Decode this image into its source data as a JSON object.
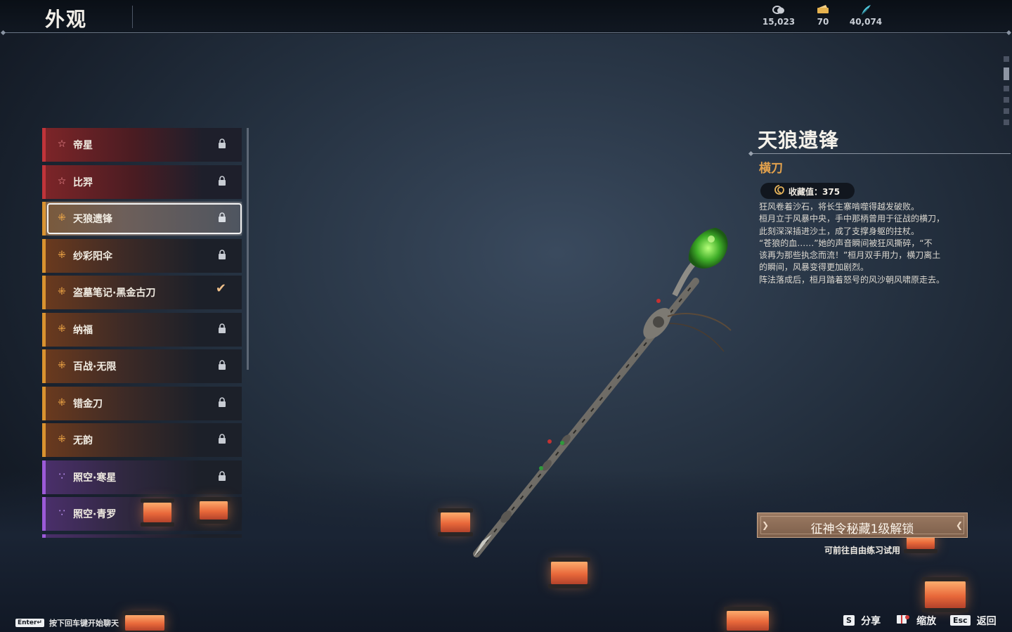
{
  "header": {
    "title": "外观",
    "currencies": [
      {
        "icon": "coin-stack-icon",
        "value": "15,023"
      },
      {
        "icon": "ticket-icon",
        "value": "70"
      },
      {
        "icon": "feather-icon",
        "value": "40,074"
      }
    ]
  },
  "list": {
    "items": [
      {
        "label": "帝星",
        "rarity": "red",
        "rarity_icon": "star-icon",
        "state": "locked"
      },
      {
        "label": "比羿",
        "rarity": "red",
        "rarity_icon": "star-icon",
        "state": "locked"
      },
      {
        "label": "天狼遗锋",
        "rarity": "gold",
        "rarity_icon": "quad-dot-icon",
        "state": "locked",
        "selected": true
      },
      {
        "label": "纱彩阳伞",
        "rarity": "gold",
        "rarity_icon": "quad-dot-icon",
        "state": "locked"
      },
      {
        "label": "盗墓笔记·黑金古刀",
        "rarity": "gold",
        "rarity_icon": "quad-dot-icon",
        "state": "owned"
      },
      {
        "label": "纳福",
        "rarity": "gold",
        "rarity_icon": "quad-dot-icon",
        "state": "locked"
      },
      {
        "label": "百战·无限",
        "rarity": "gold",
        "rarity_icon": "quad-dot-icon",
        "state": "locked"
      },
      {
        "label": "错金刀",
        "rarity": "gold",
        "rarity_icon": "quad-dot-icon",
        "state": "locked"
      },
      {
        "label": "无韵",
        "rarity": "gold",
        "rarity_icon": "quad-dot-icon",
        "state": "locked"
      },
      {
        "label": "照空·寒星",
        "rarity": "purple",
        "rarity_icon": "tri-dot-icon",
        "state": "locked"
      },
      {
        "label": "照空·青罗",
        "rarity": "purple",
        "rarity_icon": "tri-dot-icon",
        "state": "none"
      }
    ]
  },
  "detail": {
    "name": "天狼遗锋",
    "type": "横刀",
    "collection_label": "收藏值：375",
    "description": [
      "狂风卷着沙石，将长生寨啃噬得越发破败。",
      "桓月立于风暴中央，手中那柄曾用于征战的横刀，",
      "此刻深深插进沙土，成了支撑身躯的拄杖。",
      "“苍狼的血……”她的声音瞬间被狂风撕碎，“不",
      "该再为那些执念而流！”桓月双手用力，横刀离土",
      "的瞬间，风暴变得更加剧烈。",
      "阵法落成后，桓月踏着怒号的风沙朝风啸原走去。"
    ],
    "unlock_button": "征神令秘藏1级解锁",
    "unlock_hint": "可前往自由练习试用"
  },
  "footer": {
    "chat_key": "Enter↵",
    "chat_hint": "按下回车键开始聊天",
    "actions": [
      {
        "key": "S",
        "label": "分享"
      },
      {
        "key": "",
        "label": "缩放",
        "icon": "zoom-book-icon"
      },
      {
        "key": "Esc",
        "label": "返回"
      }
    ]
  },
  "colors": {
    "rarity_red": "#c0343a",
    "rarity_gold": "#d9922f",
    "rarity_purple": "#9c5ad8",
    "accent_orange": "#e3a14c"
  }
}
